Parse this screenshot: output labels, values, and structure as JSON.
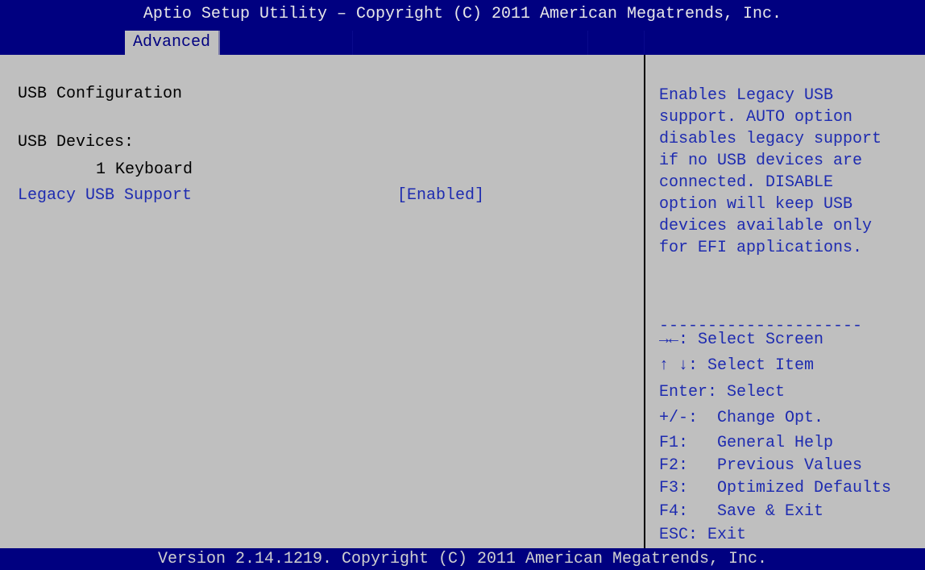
{
  "header": {
    "title": "Aptio Setup Utility – Copyright (C) 2011 American Megatrends, Inc.",
    "active_tab": "Advanced"
  },
  "main": {
    "section_title": "USB Configuration",
    "devices_label": "USB Devices:",
    "device_entry": "1 Keyboard",
    "setting_label": "Legacy USB Support",
    "setting_value": "[Enabled]"
  },
  "help": {
    "description_lines": [
      "Enables Legacy USB",
      "support. AUTO option",
      "disables legacy support",
      "if no USB devices are",
      "connected. DISABLE",
      "option will keep USB",
      "devices available only",
      "for EFI applications."
    ],
    "separator": "---------------------",
    "keys": [
      {
        "key": "→←",
        "text": ": Select Screen"
      },
      {
        "key": "↑ ↓",
        "text": ": Select Item"
      },
      {
        "key": "Enter",
        "text": ": Select"
      },
      {
        "key": "+/-",
        "text": ":  Change Opt."
      },
      {
        "key": "F1",
        "text": ":   General Help"
      },
      {
        "key": "F2",
        "text": ":   Previous Values"
      },
      {
        "key": "F3",
        "text": ":   Optimized Defaults"
      },
      {
        "key": "F4",
        "text": ":   Save & Exit"
      },
      {
        "key": "ESC",
        "text": ": Exit"
      }
    ]
  },
  "footer": {
    "version": "Version 2.14.1219. Copyright (C) 2011 American Megatrends, Inc."
  },
  "colors": {
    "header_bg": "#000080",
    "body_bg": "#bfbfbf",
    "highlight_text": "#1e2bb0",
    "header_text": "#e8e8e8"
  }
}
